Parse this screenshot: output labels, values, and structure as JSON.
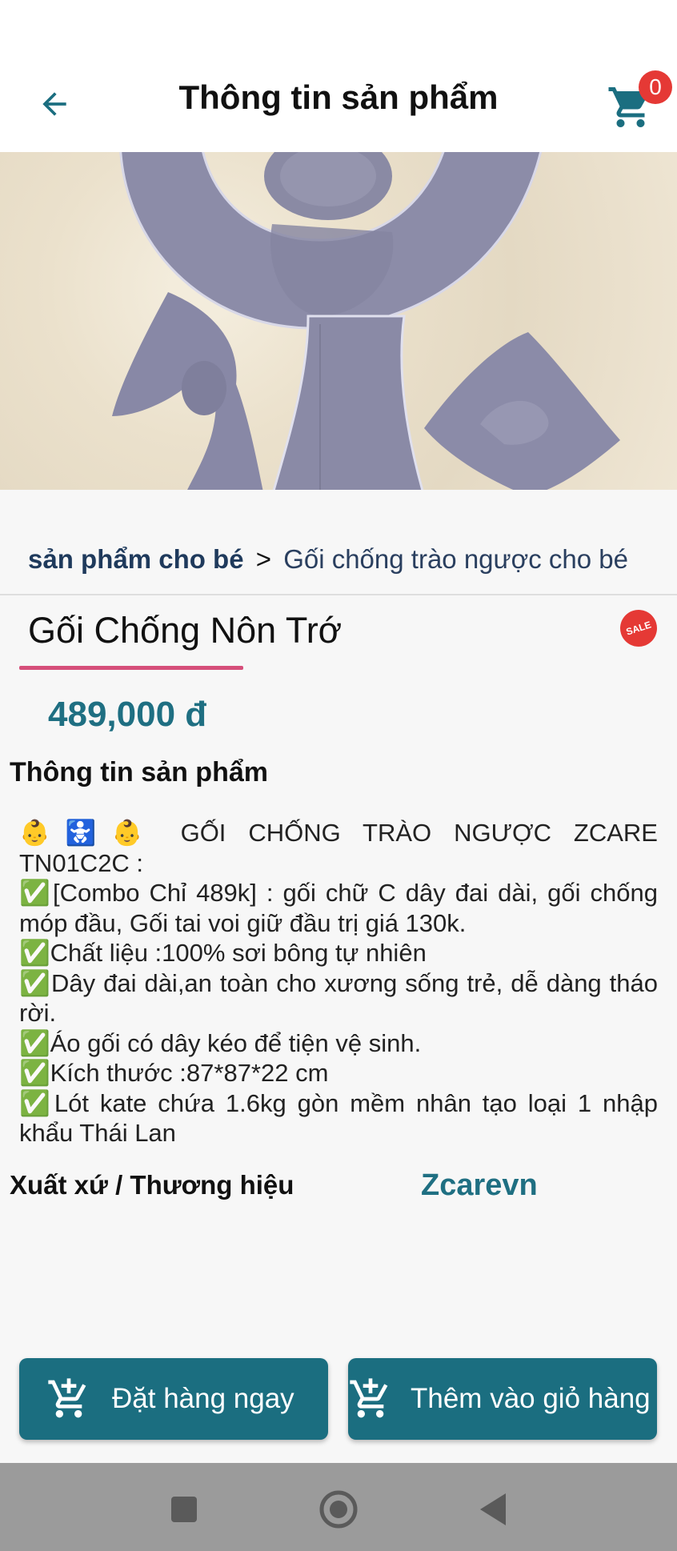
{
  "header": {
    "title": "Thông tin sản phẩm",
    "cart_count": "0"
  },
  "breadcrumb": {
    "category": "sản phẩm cho bé",
    "separator": ">",
    "subcategory": "Gối chống trào ngược cho bé"
  },
  "product": {
    "name": "Gối Chống Nôn Trớ",
    "sale_badge": "SALE",
    "price": "489,000 đ",
    "info_title": "Thông tin sản phẩm",
    "description_lines": [
      "👶🚼👶 GỐI CHỐNG TRÀO NGƯỢC ZCARE",
      "TN01C2C :",
      "✅[Combo Chỉ 489k] : gối chữ C dây đai dài, gối chống móp đầu, Gối tai voi giữ đầu trị giá 130k.",
      "✅Chất liệu :100% sơi bông tự nhiên",
      "✅Dây đai dài,an toàn cho xương sống trẻ, dễ dàng tháo rời.",
      "✅Áo gối có dây kéo để tiện vệ sinh.",
      "✅Kích thước :87*87*22 cm",
      "✅Lót kate chứa 1.6kg gòn mềm nhân tạo loại 1 nhập khẩu Thái Lan"
    ],
    "origin_label": "Xuất xứ / Thương hiệu",
    "origin_value": "Zcarevn"
  },
  "actions": {
    "order_now": "Đặt hàng ngay",
    "add_to_cart": "Thêm vào giỏ hàng"
  },
  "colors": {
    "accent": "#1b6e80",
    "price": "#1f6f82",
    "badge": "#e53935",
    "underline": "#d64f7a",
    "nav_bar": "#9b9b9b"
  },
  "icons": {
    "back": "arrow-left-icon",
    "cart": "shopping-cart-icon",
    "add_cart": "cart-plus-icon",
    "nav_recents": "square-icon",
    "nav_home": "circle-icon",
    "nav_back": "triangle-back-icon"
  }
}
